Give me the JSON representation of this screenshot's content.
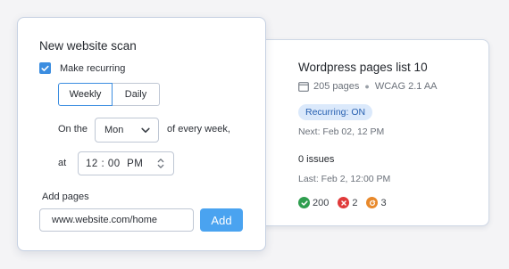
{
  "scan_form": {
    "title": "New website scan",
    "make_recurring": {
      "label": "Make recurring",
      "checked": true
    },
    "frequency": {
      "options": [
        "Weekly",
        "Daily"
      ],
      "selected": "Weekly"
    },
    "schedule": {
      "on_the_label": "On the",
      "day_value": "Mon",
      "every_week_label": "of every week,",
      "at_label": "at",
      "time": {
        "hour": "12",
        "separator": ":",
        "minute": "00",
        "period": "PM"
      }
    },
    "add_pages": {
      "label": "Add pages",
      "url_value": "www.website.com/home",
      "add_label": "Add"
    }
  },
  "report_card": {
    "title": "Wordpress pages list 10",
    "pages": "205 pages",
    "standard": "WCAG 2.1 AA",
    "recurring_badge": "Recurring: ON",
    "next_run": "Next: Feb 02, 12 PM",
    "issues": "0 issues",
    "last_run": "Last: Feb 2, 12:00 PM",
    "status_counts": [
      {
        "icon": "check-circle-icon",
        "value": "200",
        "color": "#2f9e4f"
      },
      {
        "icon": "error-circle-icon",
        "value": "2",
        "color": "#e03a3a"
      },
      {
        "icon": "redirect-circle-icon",
        "value": "3",
        "color": "#e8892b"
      }
    ]
  },
  "colors": {
    "accent": "#3b8de0",
    "add_button": "#4aa3f0",
    "badge_bg": "#dbe9fb",
    "badge_text": "#265fb0"
  }
}
